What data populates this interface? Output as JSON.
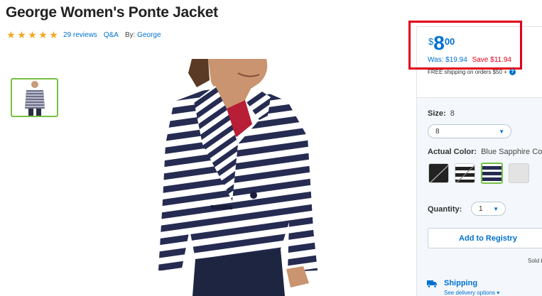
{
  "product": {
    "title": "George Women's Ponte Jacket",
    "rating_stars": 5,
    "reviews_link": "29 reviews",
    "qa_link": "Q&A",
    "by_label": "By:",
    "brand": "George"
  },
  "price": {
    "currency": "$",
    "dollars": "8",
    "cents": "00",
    "was": "Was: $19.94",
    "save": "Save $11.94",
    "shipping_note": "FREE shipping on orders $50 +",
    "info_icon_glyph": "?"
  },
  "options": {
    "size_label": "Size:",
    "size_value": "8",
    "size_select": "8",
    "color_label": "Actual Color:",
    "color_value": "Blue Sapphire Co",
    "quantity_label": "Quantity:",
    "quantity_value": "1"
  },
  "actions": {
    "registry_button": "Add to Registry",
    "sold_by": "Sold b"
  },
  "shipping": {
    "title": "Shipping",
    "delivery_link": "See delivery options ▾"
  },
  "colors": {
    "brand_blue": "#0071ce",
    "sale_red": "#e1001a",
    "highlight_red": "#e1001a",
    "selected_green": "#76c043",
    "star_gold": "#f5a623"
  },
  "icons": [
    "star-icon",
    "info-icon",
    "chevron-down-icon",
    "truck-icon"
  ]
}
